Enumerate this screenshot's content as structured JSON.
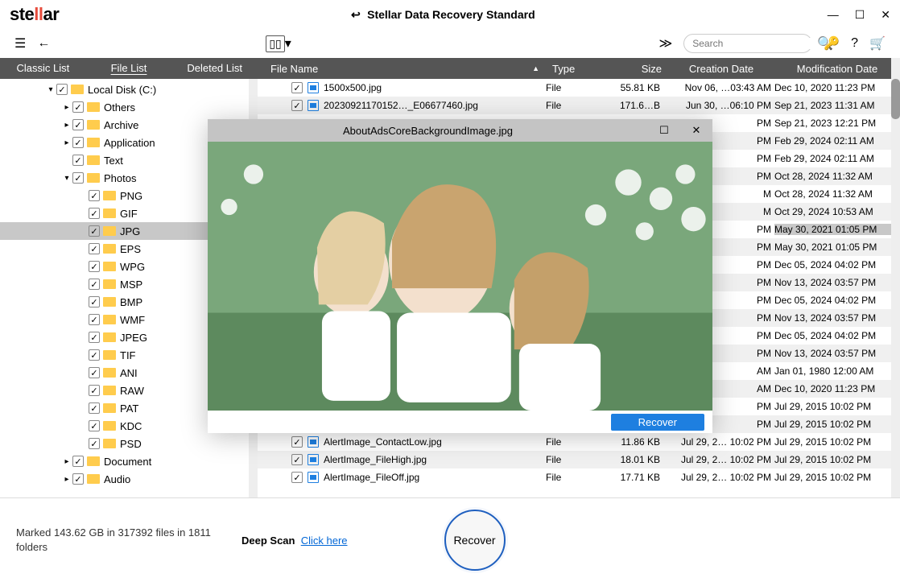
{
  "title": "Stellar Data Recovery Standard",
  "logo": {
    "pre": "ste",
    "mid": "ll",
    "post": "ar"
  },
  "search_placeholder": "Search",
  "tabs": [
    "Classic List",
    "File List",
    "Deleted List"
  ],
  "tree": {
    "root": {
      "label": "Local Disk (C:)"
    },
    "l1": [
      {
        "label": "Others",
        "chev": "▸"
      },
      {
        "label": "Archive",
        "chev": "▸"
      },
      {
        "label": "Application",
        "chev": "▸"
      },
      {
        "label": "Text",
        "chev": ""
      },
      {
        "label": "Photos",
        "chev": "▾"
      }
    ],
    "photos": [
      "PNG",
      "GIF",
      "JPG",
      "EPS",
      "WPG",
      "MSP",
      "BMP",
      "WMF",
      "JPEG",
      "TIF",
      "ANI",
      "RAW",
      "PAT",
      "KDC",
      "PSD"
    ],
    "after": [
      {
        "label": "Document",
        "chev": "▸"
      },
      {
        "label": "Audio",
        "chev": "▸"
      }
    ]
  },
  "cols": {
    "name": "File Name",
    "type": "Type",
    "size": "Size",
    "creation": "Creation Date",
    "modification": "Modification Date"
  },
  "rows": [
    {
      "name": "1500x500.jpg",
      "type": "File",
      "size": "55.81 KB",
      "c": "Nov 06, …03:43 AM",
      "m": "Dec 10, 2020 11:23 PM"
    },
    {
      "name": "20230921170152…_E06677460.jpg",
      "type": "File",
      "size": "171.6…B",
      "c": "Jun 30, …06:10 PM",
      "m": "Sep 21, 2023 11:31 AM"
    },
    {
      "name": "",
      "type": "",
      "size": "",
      "c": "PM",
      "m": "Sep 21, 2023 12:21 PM"
    },
    {
      "name": "",
      "type": "",
      "size": "",
      "c": "PM",
      "m": "Feb 29, 2024 02:11 AM"
    },
    {
      "name": "",
      "type": "",
      "size": "",
      "c": "PM",
      "m": "Feb 29, 2024 02:11 AM"
    },
    {
      "name": "",
      "type": "",
      "size": "",
      "c": "PM",
      "m": "Oct 28, 2024 11:32 AM"
    },
    {
      "name": "",
      "type": "",
      "size": "",
      "c": "M",
      "m": "Oct 28, 2024 11:32 AM"
    },
    {
      "name": "",
      "type": "",
      "size": "",
      "c": "M",
      "m": "Oct 29, 2024 10:53 AM"
    },
    {
      "name": "",
      "type": "",
      "size": "",
      "c": "PM",
      "m": "May 30, 2021 01:05 PM",
      "sel": true
    },
    {
      "name": "",
      "type": "",
      "size": "",
      "c": "PM",
      "m": "May 30, 2021 01:05 PM"
    },
    {
      "name": "",
      "type": "",
      "size": "",
      "c": "PM",
      "m": "Dec 05, 2024 04:02 PM"
    },
    {
      "name": "",
      "type": "",
      "size": "",
      "c": "PM",
      "m": "Nov 13, 2024 03:57 PM"
    },
    {
      "name": "",
      "type": "",
      "size": "",
      "c": "PM",
      "m": "Dec 05, 2024 04:02 PM"
    },
    {
      "name": "",
      "type": "",
      "size": "",
      "c": "PM",
      "m": "Nov 13, 2024 03:57 PM"
    },
    {
      "name": "",
      "type": "",
      "size": "",
      "c": "PM",
      "m": "Dec 05, 2024 04:02 PM"
    },
    {
      "name": "",
      "type": "",
      "size": "",
      "c": "PM",
      "m": "Nov 13, 2024 03:57 PM"
    },
    {
      "name": "",
      "type": "",
      "size": "",
      "c": "AM",
      "m": "Jan 01, 1980 12:00 AM"
    },
    {
      "name": "",
      "type": "",
      "size": "",
      "c": "AM",
      "m": "Dec 10, 2020 11:23 PM"
    },
    {
      "name": "",
      "type": "",
      "size": "",
      "c": "PM",
      "m": "Jul 29, 2015 10:02 PM"
    },
    {
      "name": "",
      "type": "",
      "size": "",
      "c": "PM",
      "m": "Jul 29, 2015 10:02 PM"
    },
    {
      "name": "AlertImage_ContactLow.jpg",
      "type": "File",
      "size": "11.86 KB",
      "c": "Jul 29, 2… 10:02 PM",
      "m": "Jul 29, 2015 10:02 PM"
    },
    {
      "name": "AlertImage_FileHigh.jpg",
      "type": "File",
      "size": "18.01 KB",
      "c": "Jul 29, 2… 10:02 PM",
      "m": "Jul 29, 2015 10:02 PM"
    },
    {
      "name": "AlertImage_FileOff.jpg",
      "type": "File",
      "size": "17.71 KB",
      "c": "Jul 29, 2… 10:02 PM",
      "m": "Jul 29, 2015 10:02 PM"
    }
  ],
  "preview": {
    "title": "AboutAdsCoreBackgroundImage.jpg",
    "recover": "Recover"
  },
  "footer": {
    "marked": "Marked 143.62 GB in 317392 files in 1811 folders",
    "deep": "Deep Scan",
    "click": "Click here",
    "recover": "Recover"
  }
}
